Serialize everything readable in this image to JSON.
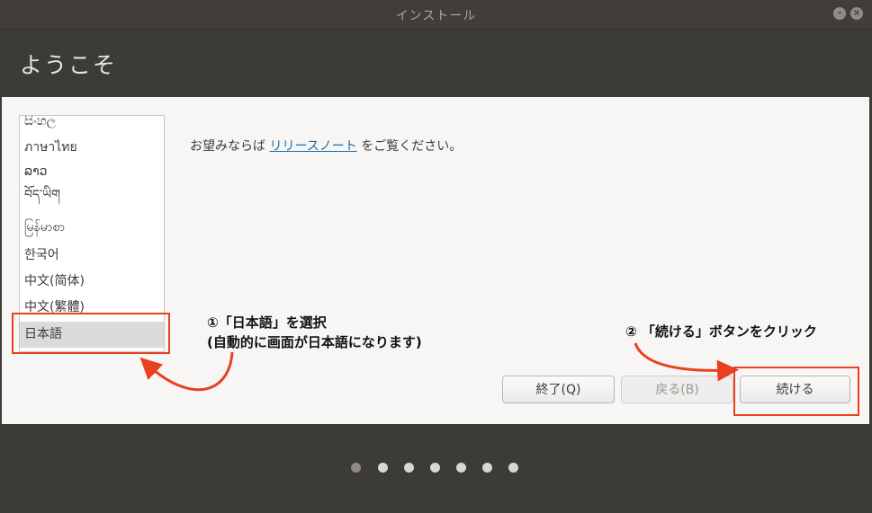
{
  "window": {
    "title": "インストール",
    "minimize_icon": "minimize-icon",
    "close_icon": "close-icon"
  },
  "header": {
    "title": "ようこそ"
  },
  "languages": [
    "සිංහල",
    "ภาษาไทย",
    "ລາວ",
    "བོད་ཡིག",
    "မြန်မာစာ",
    "한국어",
    "中文(简体)",
    "中文(繁體)",
    "日本語"
  ],
  "selected_language": "日本語",
  "release_notes": {
    "prefix": "お望みならば ",
    "link": "リリースノート",
    "suffix": " をご覧ください。"
  },
  "buttons": {
    "quit": "終了(Q)",
    "back": "戻る(B)",
    "continue": "続ける"
  },
  "progress": {
    "total_steps": 7,
    "current_step": 1
  },
  "annotations": {
    "step1_line1": "①「日本語」を選択",
    "step1_line2": "(自動的に画面が日本語になります)",
    "step2": "② 「続ける」ボタンをクリック",
    "highlight_color": "#e8411f"
  }
}
